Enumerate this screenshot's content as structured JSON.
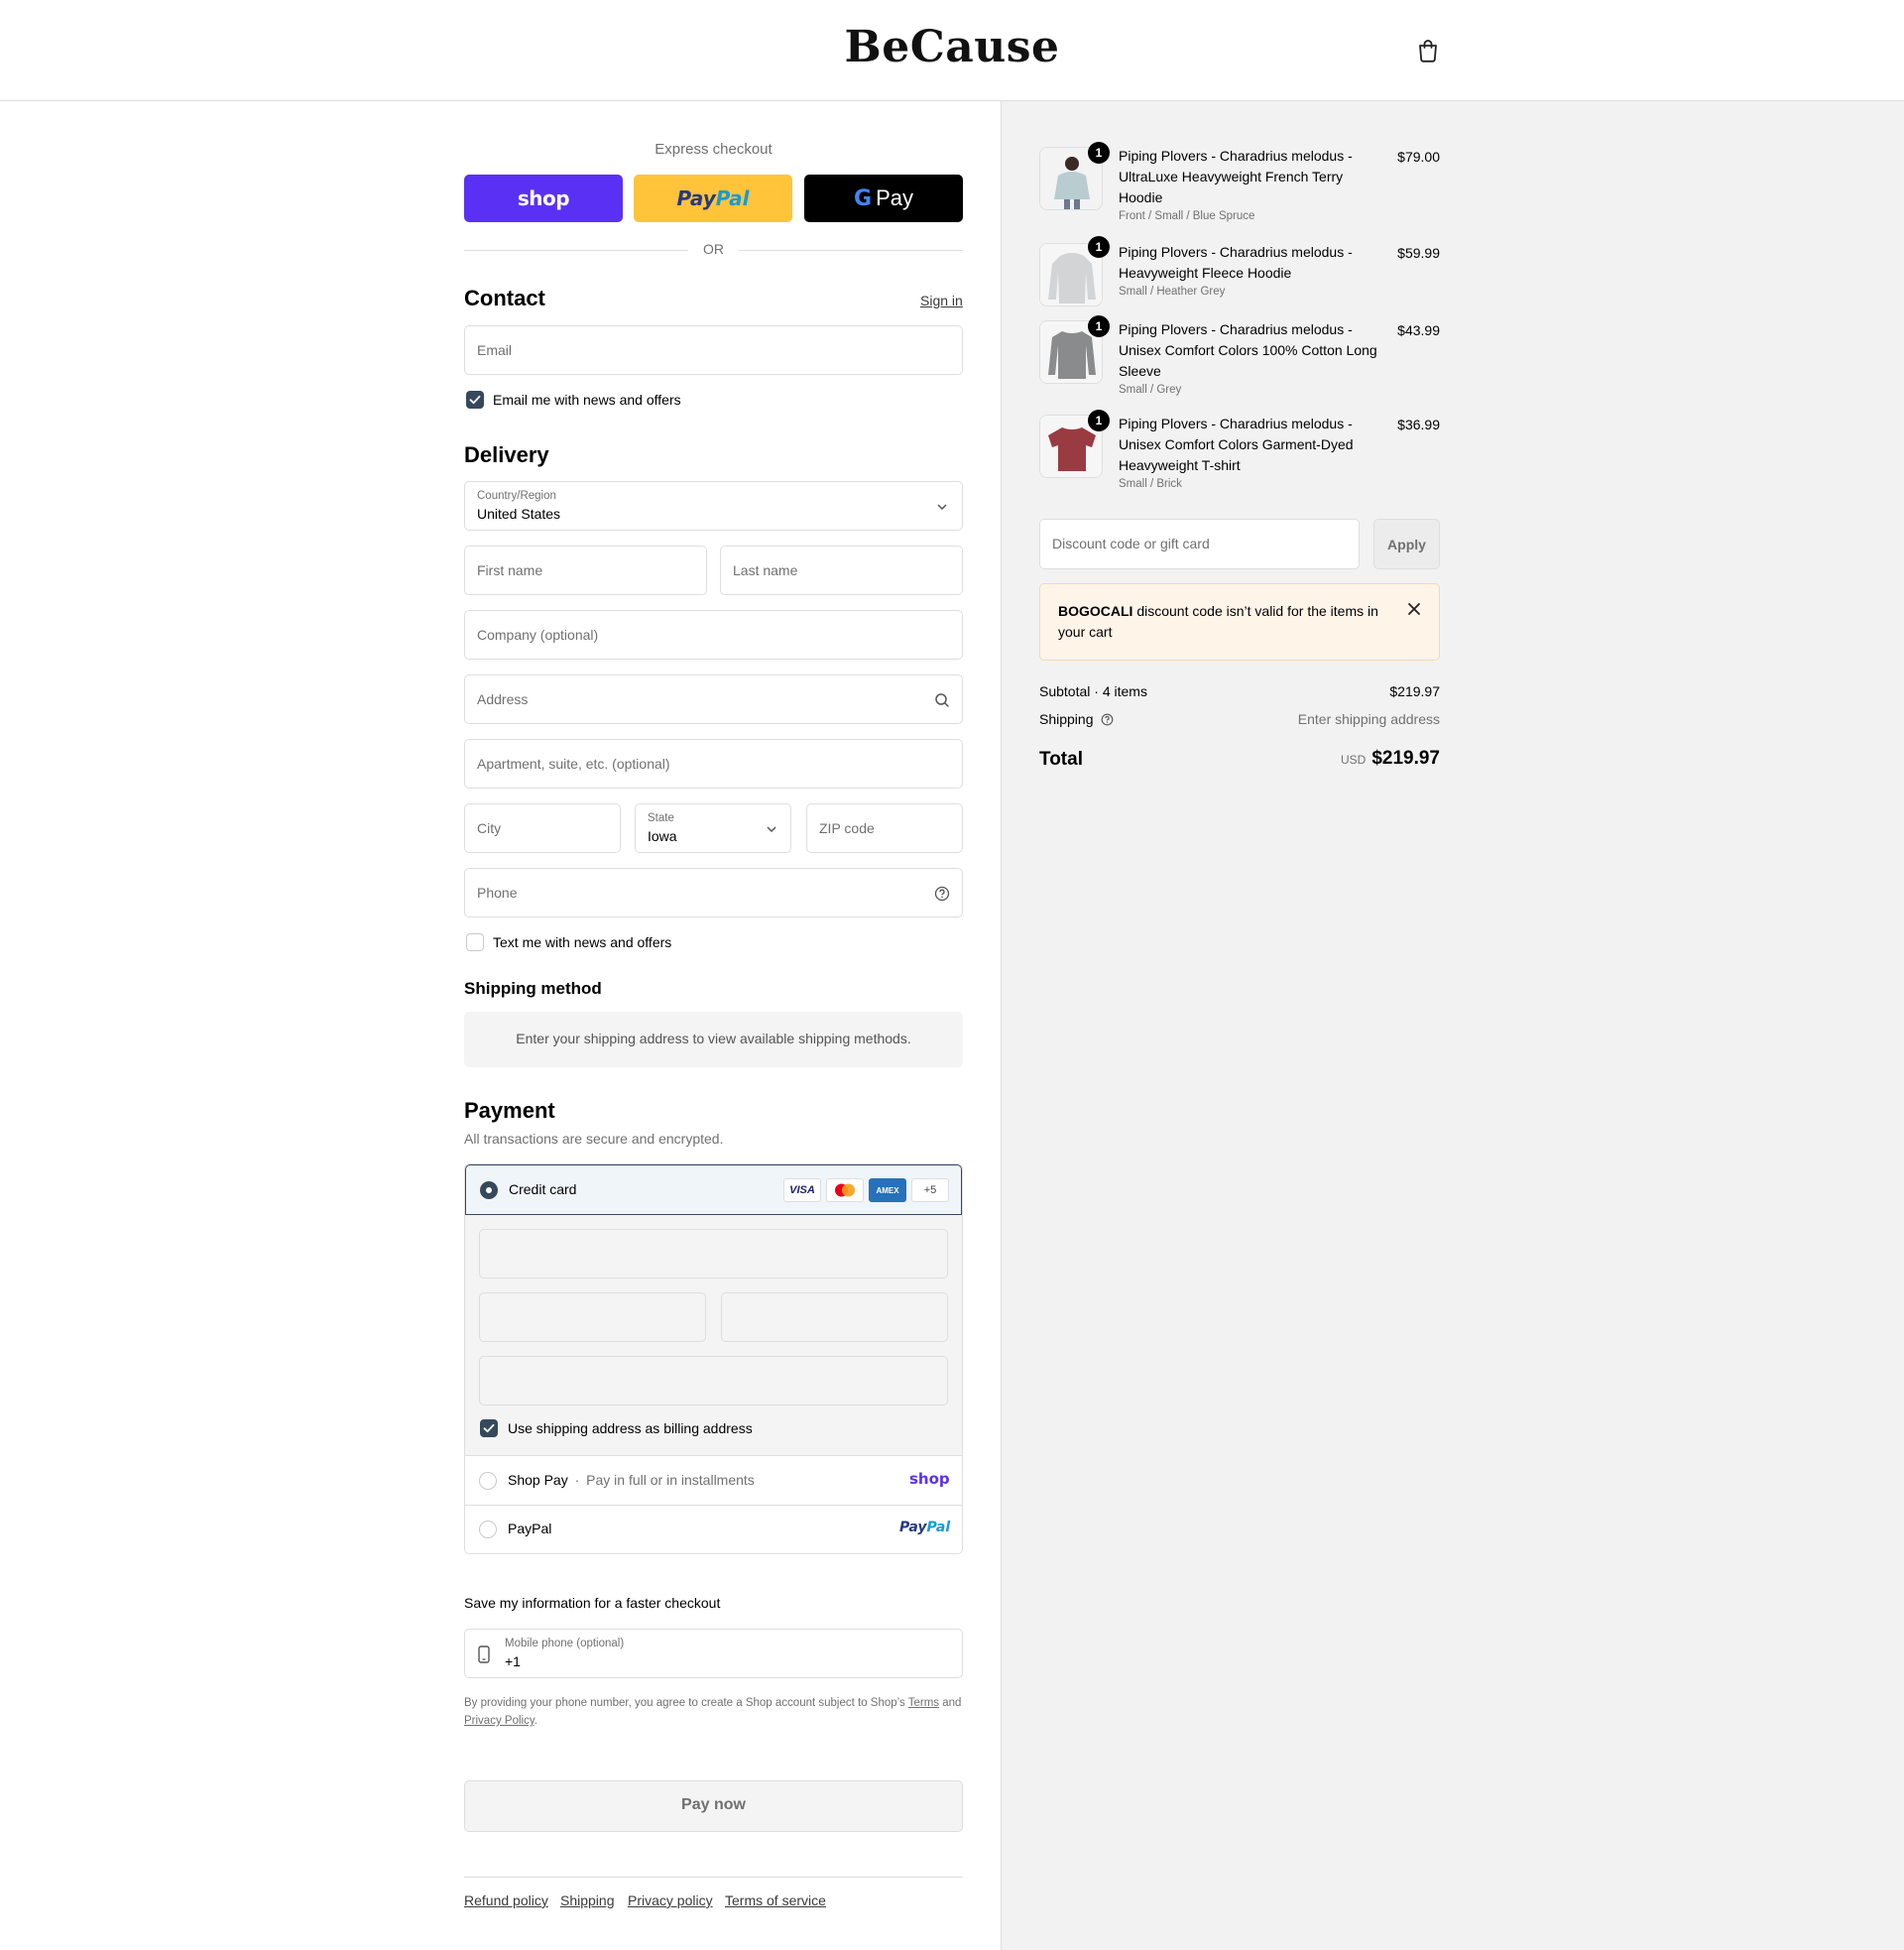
{
  "brand": {
    "logo": "BeCause"
  },
  "express": {
    "label": "Express checkout",
    "shop_label": "shop",
    "paypal_label_a": "Pay",
    "paypal_label_b": "Pal",
    "gpay_label": "Pay",
    "or": "OR"
  },
  "contact": {
    "heading": "Contact",
    "signin": "Sign in",
    "email_placeholder": "Email",
    "news_checkbox": "Email me with news and offers"
  },
  "delivery": {
    "heading": "Delivery",
    "country_label": "Country/Region",
    "country_value": "United States",
    "first_name": "First name",
    "last_name": "Last name",
    "company": "Company (optional)",
    "address": "Address",
    "apartment": "Apartment, suite, etc. (optional)",
    "city": "City",
    "state_label": "State",
    "state_value": "Iowa",
    "zip": "ZIP code",
    "phone": "Phone",
    "text_checkbox": "Text me with news and offers"
  },
  "shipping_method": {
    "heading": "Shipping method",
    "message": "Enter your shipping address to view available shipping methods."
  },
  "payment": {
    "heading": "Payment",
    "subtitle": "All transactions are secure and encrypted.",
    "credit_card": "Credit card",
    "card_badges": [
      "VISA",
      "",
      "AMEX",
      "+5"
    ],
    "billing_checkbox": "Use shipping address as billing address",
    "shop_pay": "Shop Pay",
    "shop_pay_sep": "·",
    "shop_pay_desc": "Pay in full or in installments",
    "shop_pay_logo": "shop",
    "paypal": "PayPal",
    "paypal_logo_a": "Pay",
    "paypal_logo_b": "Pal"
  },
  "save_info": {
    "heading": "Save my information for a faster checkout",
    "mobile_label": "Mobile phone (optional)",
    "mobile_value": "+1",
    "terms_prefix": "By providing your phone number, you agree to create a Shop account subject to Shop’s",
    "terms_link": "Terms",
    "terms_and": "and",
    "privacy_link": "Privacy Policy",
    "terms_end": "."
  },
  "pay_now": "Pay now",
  "footer_links": [
    "Refund policy",
    "Shipping",
    "Privacy policy",
    "Terms of service"
  ],
  "cart": {
    "items": [
      {
        "qty": "1",
        "title": "Piping Plovers - Charadrius melodus - UltraLuxe Heavyweight French Terry Hoodie",
        "variant": "Front / Small / Blue Spruce",
        "price": "$79.00",
        "color": "#b9ccd0"
      },
      {
        "qty": "1",
        "title": "Piping Plovers - Charadrius melodus - Heavyweight Fleece Hoodie",
        "variant": "Small / Heather Grey",
        "price": "$59.99",
        "color": "#d2d4d6"
      },
      {
        "qty": "1",
        "title": "Piping Plovers - Charadrius melodus - Unisex Comfort Colors 100% Cotton Long Sleeve",
        "variant": "Small / Grey",
        "price": "$43.99",
        "color": "#8a8b8c"
      },
      {
        "qty": "1",
        "title": "Piping Plovers - Charadrius melodus - Unisex Comfort Colors Garment-Dyed Heavyweight T-shirt",
        "variant": "Small / Brick",
        "price": "$36.99",
        "color": "#9a3b42"
      }
    ],
    "discount_placeholder": "Discount code or gift card",
    "apply": "Apply",
    "warning_code": "BOGOCALI",
    "warning_text": " discount code isn’t valid for the items in your cart",
    "subtotal_label": "Subtotal · 4 items",
    "subtotal_value": "$219.97",
    "shipping_label": "Shipping",
    "shipping_value": "Enter shipping address",
    "total_label": "Total",
    "total_currency": "USD",
    "total_value": "$219.97"
  },
  "colors": {
    "shop_purple": "#5a31f4",
    "paypal_yellow": "#ffc439",
    "gpay_black": "#000000",
    "accent": "#36495c",
    "warning_bg": "#fff4e8"
  }
}
